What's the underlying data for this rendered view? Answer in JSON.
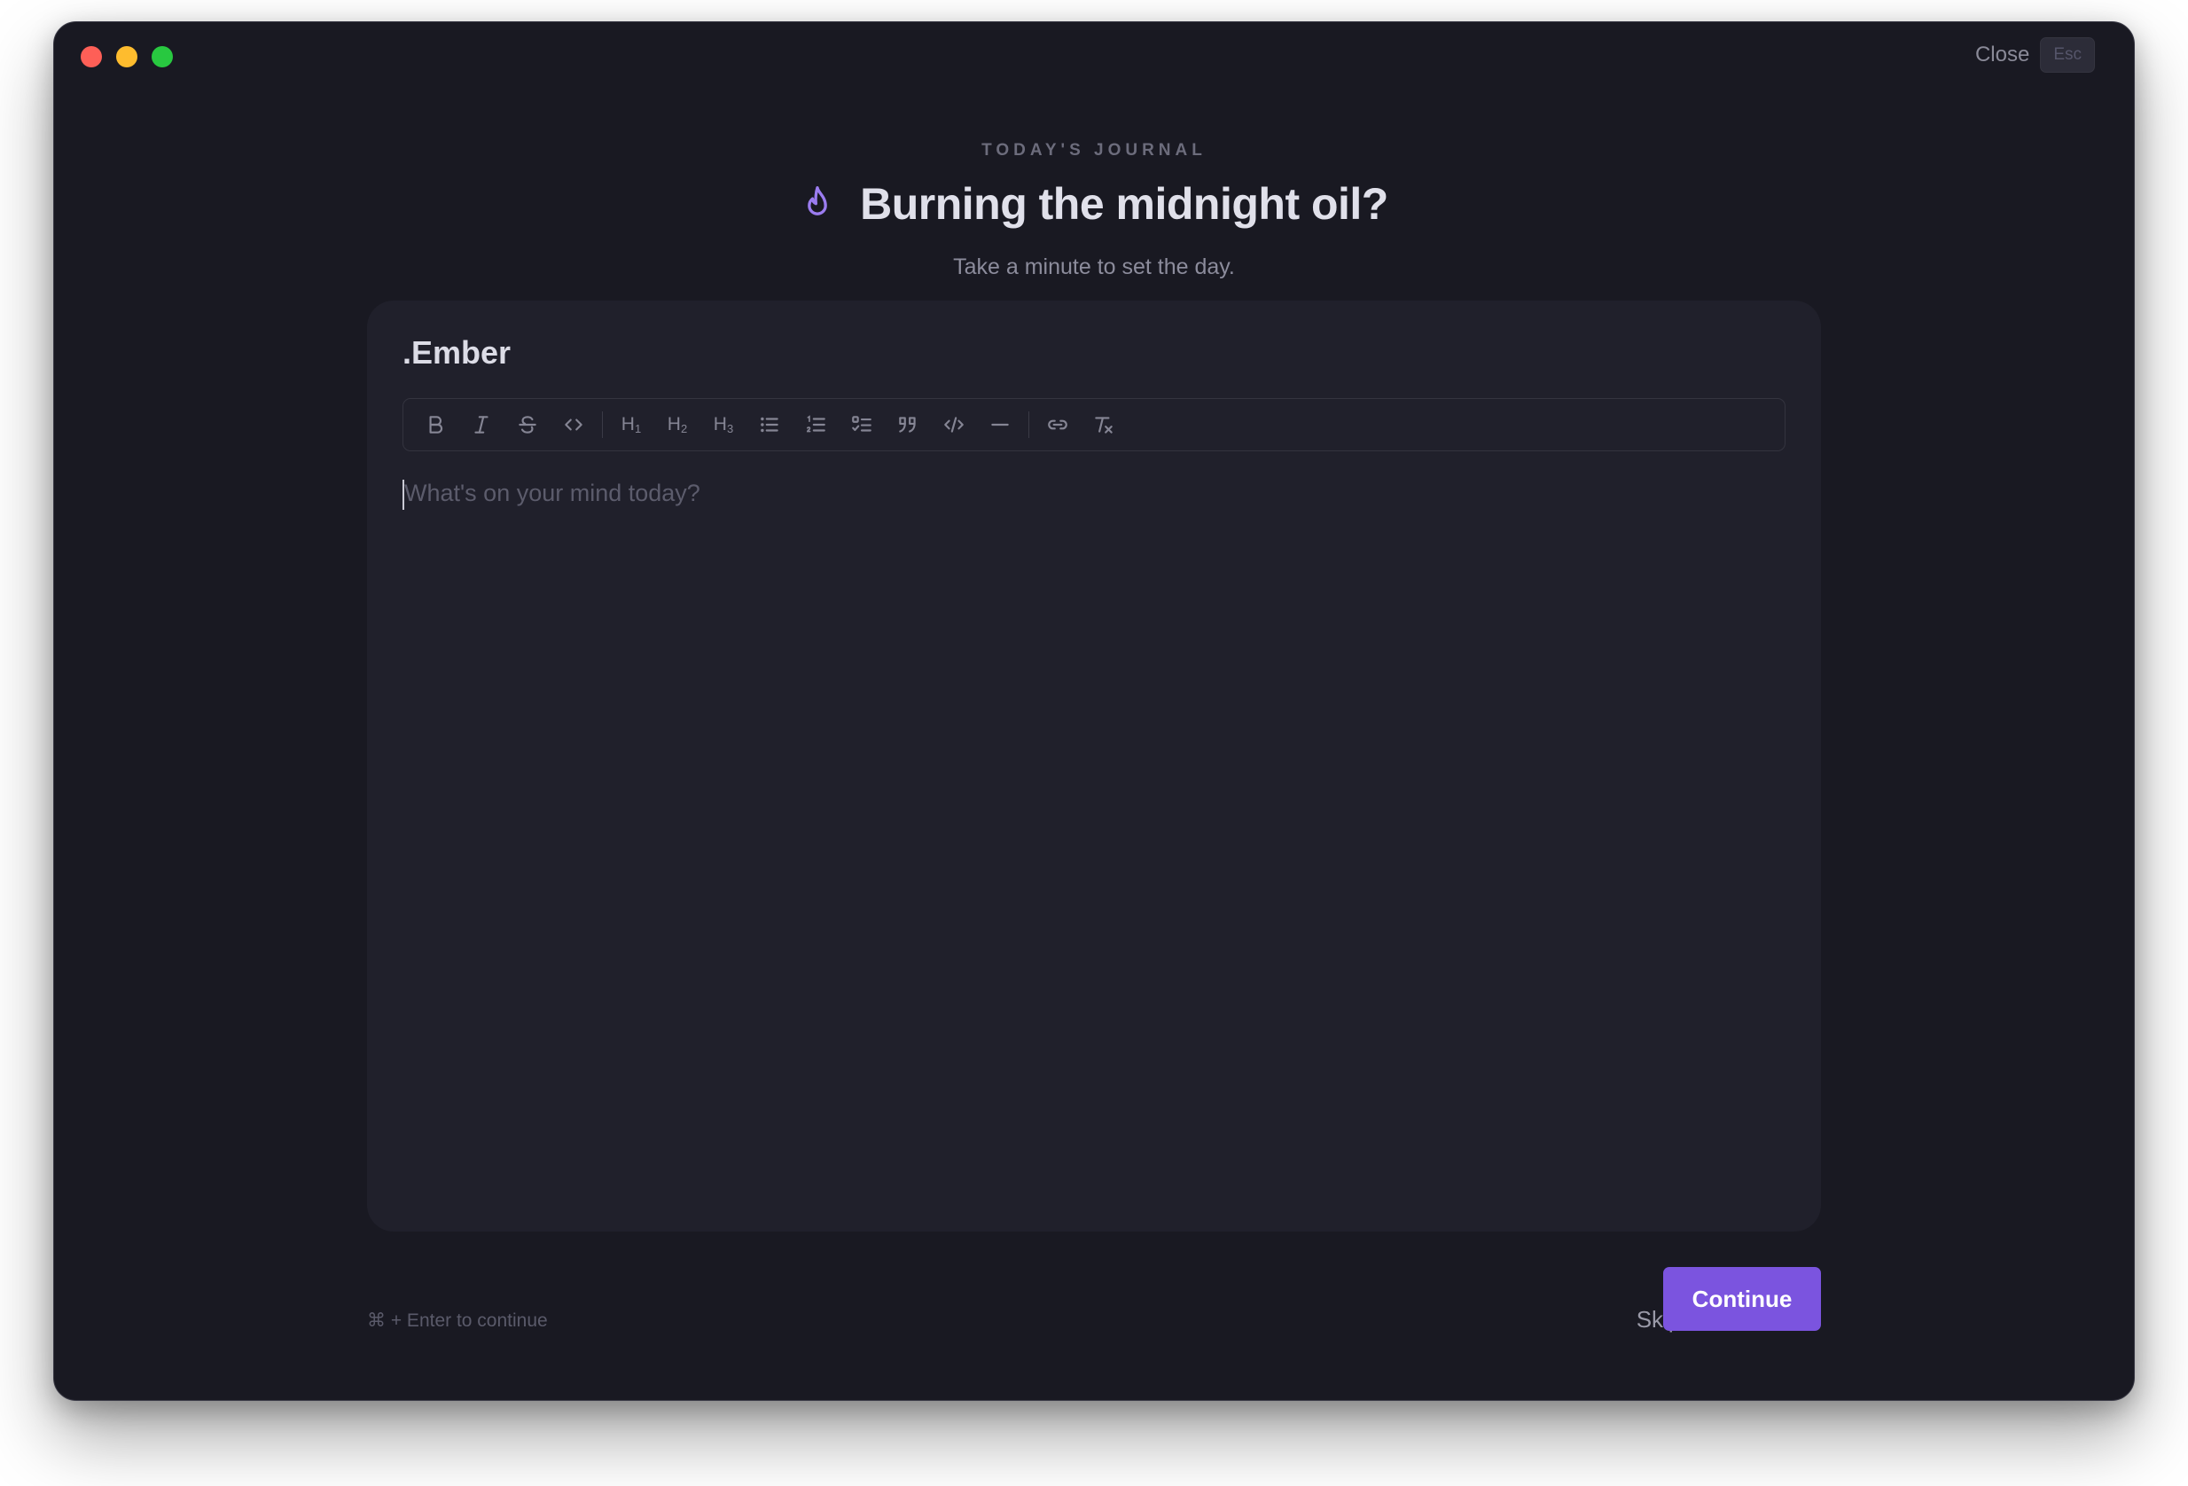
{
  "window": {
    "close_label": "Close",
    "close_shortcut": "Esc"
  },
  "header": {
    "kicker": "TODAY'S JOURNAL",
    "title_icon": "flame-icon",
    "title": "Burning the midnight oil?",
    "subtitle": "Take a minute to set the day."
  },
  "editor": {
    "entry_title": ".Ember",
    "placeholder": "What's on your mind today?",
    "toolbar": [
      {
        "name": "bold",
        "icon": "bold-icon"
      },
      {
        "name": "italic",
        "icon": "italic-icon"
      },
      {
        "name": "strikethrough",
        "icon": "strikethrough-icon"
      },
      {
        "name": "inline-code",
        "icon": "code-icon"
      },
      {
        "name": "heading-1",
        "icon": "heading-1-icon",
        "label": "H",
        "level": "1"
      },
      {
        "name": "heading-2",
        "icon": "heading-2-icon",
        "label": "H",
        "level": "2"
      },
      {
        "name": "heading-3",
        "icon": "heading-3-icon",
        "label": "H",
        "level": "3"
      },
      {
        "name": "bullet-list",
        "icon": "bullet-list-icon"
      },
      {
        "name": "ordered-list",
        "icon": "ordered-list-icon"
      },
      {
        "name": "task-list",
        "icon": "task-list-icon"
      },
      {
        "name": "blockquote",
        "icon": "quote-icon"
      },
      {
        "name": "code-block",
        "icon": "code-block-icon"
      },
      {
        "name": "horizontal-rule",
        "icon": "horizontal-rule-icon"
      },
      {
        "name": "link",
        "icon": "link-icon"
      },
      {
        "name": "clear-formatting",
        "icon": "clear-format-icon"
      }
    ]
  },
  "footer": {
    "hint": "⌘ + Enter to continue",
    "skip_label": "Skip",
    "continue_label": "Continue"
  },
  "colors": {
    "window_bg": "#191922",
    "card_bg": "#20202b",
    "accent": "#7b54df",
    "flame": "#9b7cf0"
  }
}
